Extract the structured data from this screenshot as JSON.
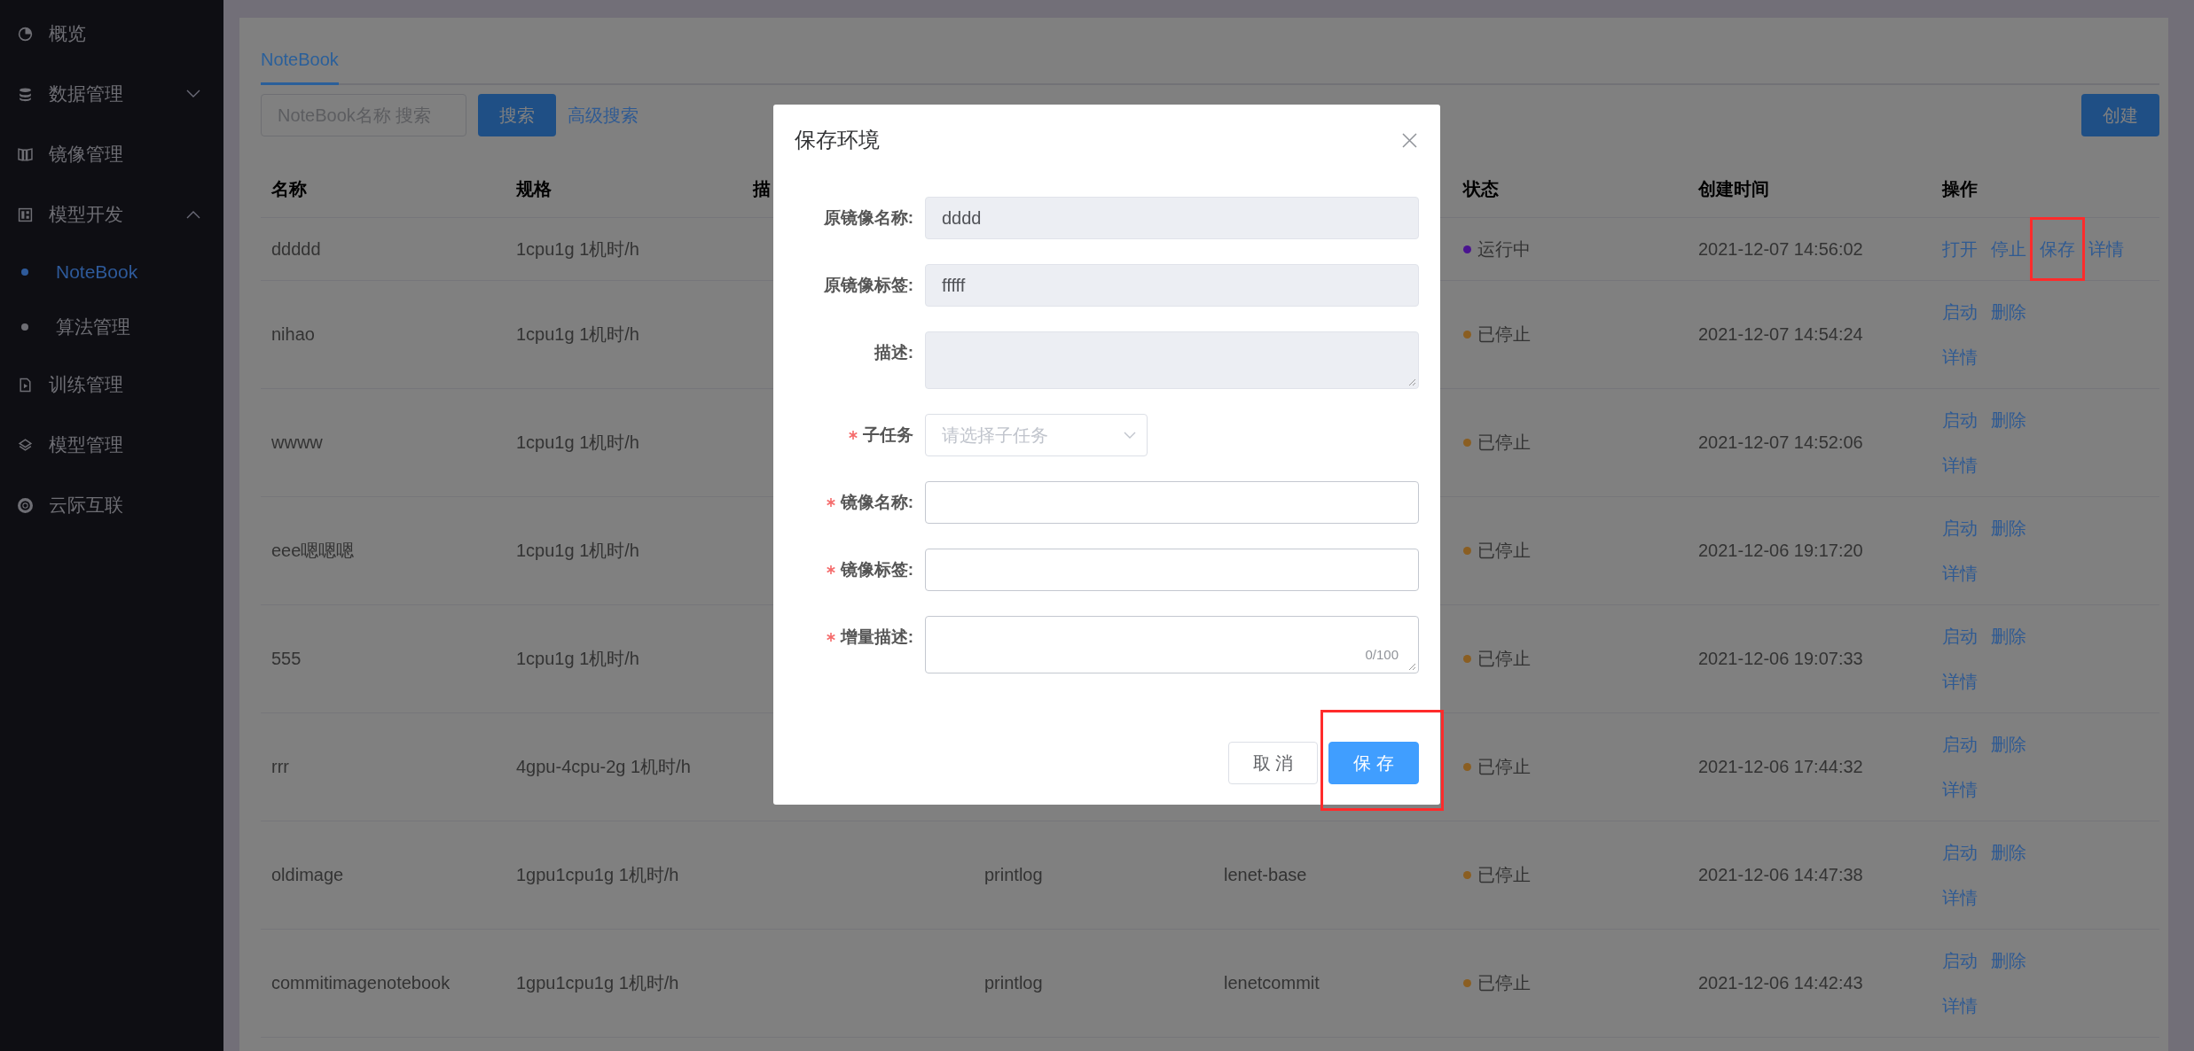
{
  "sidebar": {
    "items": [
      {
        "label": "概览",
        "selected": false
      },
      {
        "label": "数据管理",
        "selected": false,
        "expanded": false
      },
      {
        "label": "镜像管理",
        "selected": false
      },
      {
        "label": "模型开发",
        "selected": false,
        "expanded": true,
        "children": [
          {
            "label": "NoteBook",
            "selected": true
          },
          {
            "label": "算法管理",
            "selected": false
          }
        ]
      },
      {
        "label": "训练管理",
        "selected": false
      },
      {
        "label": "模型管理",
        "selected": false
      },
      {
        "label": "云际互联",
        "selected": false
      }
    ]
  },
  "tabs": [
    {
      "label": "NoteBook",
      "selected": true
    }
  ],
  "toolbar": {
    "search": {
      "placeholder": "NoteBook名称 搜索"
    },
    "search_button": "搜索",
    "advanced_link": "高级搜索",
    "create_button": "创建"
  },
  "table": {
    "columns": [
      "名称",
      "规格",
      "描",
      "状态",
      "创建时间",
      "操作"
    ],
    "rows": [
      {
        "name": "ddddd",
        "spec": "1cpu1g 1机时/h",
        "status": {
          "label": "运行中",
          "color": "#4a1490"
        },
        "created": "2021-12-07 14:56:02",
        "action_lines": [
          [
            {
              "label": "打开",
              "highlighted": false
            },
            {
              "label": "停止",
              "highlighted": false
            },
            {
              "label": "保存",
              "highlighted": true
            },
            {
              "label": "详情",
              "highlighted": false
            }
          ]
        ]
      },
      {
        "name": "nihao",
        "spec": "1cpu1g 1机时/h",
        "status": {
          "label": "已停止",
          "color": "#8a5e22"
        },
        "created": "2021-12-07 14:54:24",
        "action_lines": [
          [
            {
              "label": "启动",
              "highlighted": false
            },
            {
              "label": "删除",
              "highlighted": false
            }
          ],
          [
            {
              "label": "详情",
              "highlighted": false
            }
          ]
        ]
      },
      {
        "name": "wwww",
        "spec": "1cpu1g 1机时/h",
        "status": {
          "label": "已停止",
          "color": "#8a5e22"
        },
        "created": "2021-12-07 14:52:06",
        "action_lines": [
          [
            {
              "label": "启动",
              "highlighted": false
            },
            {
              "label": "删除",
              "highlighted": false
            }
          ],
          [
            {
              "label": "详情",
              "highlighted": false
            }
          ]
        ]
      },
      {
        "name": "eee嗯嗯嗯",
        "spec": "1cpu1g 1机时/h",
        "status": {
          "label": "已停止",
          "color": "#8a5e22"
        },
        "created": "2021-12-06 19:17:20",
        "action_lines": [
          [
            {
              "label": "启动",
              "highlighted": false
            },
            {
              "label": "删除",
              "highlighted": false
            }
          ],
          [
            {
              "label": "详情",
              "highlighted": false
            }
          ]
        ]
      },
      {
        "name": "555",
        "spec": "1cpu1g 1机时/h",
        "status": {
          "label": "已停止",
          "color": "#8a5e22"
        },
        "created": "2021-12-06 19:07:33",
        "action_lines": [
          [
            {
              "label": "启动",
              "highlighted": false
            },
            {
              "label": "删除",
              "highlighted": false
            }
          ],
          [
            {
              "label": "详情",
              "highlighted": false
            }
          ]
        ]
      },
      {
        "name": "rrr",
        "spec": "4gpu-4cpu-2g 1机时/h",
        "status": {
          "label": "已停止",
          "color": "#8a5e22"
        },
        "created": "2021-12-06 17:44:32",
        "action_lines": [
          [
            {
              "label": "启动",
              "highlighted": false
            },
            {
              "label": "删除",
              "highlighted": false
            }
          ],
          [
            {
              "label": "详情",
              "highlighted": false
            }
          ]
        ]
      },
      {
        "name": "oldimage",
        "spec": "1gpu1cpu1g 1机时/h",
        "column_4": "printlog",
        "column_5": "lenet-base",
        "status": {
          "label": "已停止",
          "color": "#8a5e22"
        },
        "created": "2021-12-06 14:47:38",
        "action_lines": [
          [
            {
              "label": "启动",
              "highlighted": false
            },
            {
              "label": "删除",
              "highlighted": false
            }
          ],
          [
            {
              "label": "详情",
              "highlighted": false
            }
          ]
        ]
      },
      {
        "name": "commitimagenotebook",
        "spec": "1gpu1cpu1g 1机时/h",
        "column_4": "printlog",
        "column_5": "lenetcommit",
        "status": {
          "label": "已停止",
          "color": "#8a5e22"
        },
        "created": "2021-12-06 14:42:43",
        "action_lines": [
          [
            {
              "label": "启动",
              "highlighted": false
            },
            {
              "label": "删除",
              "highlighted": false
            }
          ],
          [
            {
              "label": "详情",
              "highlighted": false
            }
          ]
        ]
      }
    ]
  },
  "dialog": {
    "title": "保存环境",
    "fields": [
      {
        "label": "原镜像名称:",
        "kind": "input",
        "required": false,
        "disabled": true,
        "value": "dddd"
      },
      {
        "label": "原镜像标签:",
        "kind": "input",
        "required": false,
        "disabled": true,
        "value": "fffff"
      },
      {
        "label": "描述:",
        "kind": "textarea",
        "required": false,
        "disabled": true
      },
      {
        "label": "子任务",
        "kind": "select",
        "required": true,
        "disabled": false,
        "placeholder": "请选择子任务"
      },
      {
        "label": "镜像名称:",
        "kind": "input",
        "required": true,
        "disabled": false
      },
      {
        "label": "镜像标签:",
        "kind": "input",
        "required": true,
        "disabled": false
      },
      {
        "label": "增量描述:",
        "kind": "textarea",
        "required": true,
        "disabled": false,
        "counter": "0/100"
      }
    ],
    "buttons": [
      {
        "label": "取 消",
        "kind": "default",
        "highlighted": false
      },
      {
        "label": "保 存",
        "kind": "primary",
        "highlighted": true
      }
    ]
  }
}
